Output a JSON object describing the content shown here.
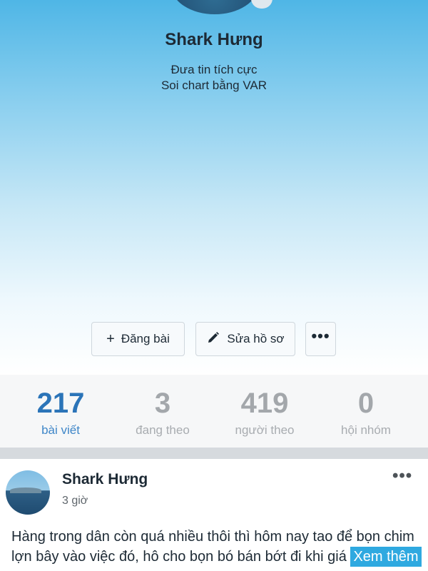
{
  "profile": {
    "name": "Shark Hưng",
    "bio_line1": "Đưa tin tích cực",
    "bio_line2": "Soi chart bằng VAR"
  },
  "actions": {
    "post_label": "Đăng bài",
    "post_icon": "plus-icon",
    "edit_label": "Sửa hồ sơ",
    "edit_icon": "pencil-icon",
    "more_icon": "more-horizontal-icon",
    "more_label": "•••"
  },
  "stats": [
    {
      "value": "217",
      "label": "bài viết",
      "active": true
    },
    {
      "value": "3",
      "label": "đang theo",
      "active": false
    },
    {
      "value": "419",
      "label": "người theo",
      "active": false
    },
    {
      "value": "0",
      "label": "hội nhóm",
      "active": false
    }
  ],
  "post": {
    "author": "Shark Hưng",
    "time": "3 giờ",
    "menu_label": "•••",
    "text": "Hàng trong dân còn quá nhiều thôi thì hôm nay tao để bọn chim lợn bây vào việc đó, hô cho bọn bó bán bớt đi khi giá",
    "tag": "Xem thêm"
  },
  "colors": {
    "accent": "#2b74b8",
    "header_top": "#4fb6e6",
    "tag_bg": "#2fa9e0"
  }
}
